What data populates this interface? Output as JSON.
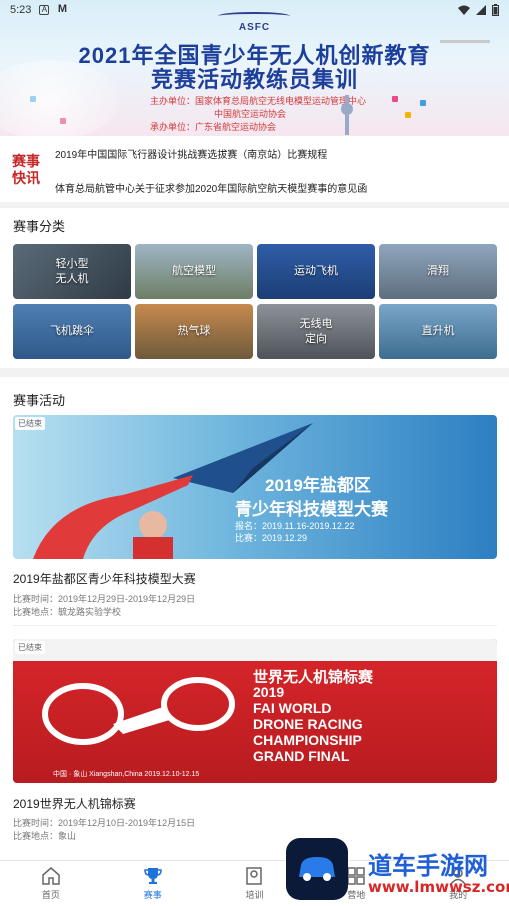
{
  "status_bar": {
    "time": "5:23",
    "icons": [
      "a-icon",
      "m-icon"
    ]
  },
  "banner": {
    "logo": "ASFC",
    "title_line1": "2021年全国青少年无人机创新教育",
    "title_line2": "竞赛活动教练员集训",
    "host": "主办单位：国家体育总局航空无线电模型运动管理中心",
    "host2": "中国航空运动协会",
    "organizer": "承办单位：广东省航空运动协会"
  },
  "news": {
    "badge": "赛事快讯",
    "items": [
      "2019年中国国际飞行器设计挑战赛选拔赛（南京站）比赛规程",
      "体育总局航管中心关于征求参加2020年国际航空航天模型赛事的意见函"
    ]
  },
  "categories": {
    "title": "赛事分类",
    "items": [
      {
        "label": "轻小型\n无人机"
      },
      {
        "label": "航空模型"
      },
      {
        "label": "运动飞机"
      },
      {
        "label": "滑翔"
      },
      {
        "label": "飞机跳伞"
      },
      {
        "label": "热气球"
      },
      {
        "label": "无线电\n定向"
      },
      {
        "label": "直升机"
      }
    ]
  },
  "events": {
    "title": "赛事活动",
    "items": [
      {
        "tag": "已结束",
        "poster_title1": "2019年盐都区",
        "poster_title2": "青少年科技模型大赛",
        "poster_line1": "报名：2019.11.16-2019.12.22",
        "poster_line2": "比赛：2019.12.29",
        "title": "2019年盐都区青少年科技模型大赛",
        "time": "比赛时间：2019年12月29日-2019年12月29日",
        "location": "比赛地点：毓龙路实验学校"
      },
      {
        "tag": "已结束",
        "poster_cn": "世界无人机锦标赛",
        "poster_en1": "2019",
        "poster_en2": "FAI WORLD",
        "poster_en3": "DRONE RACING",
        "poster_en4": "CHAMPIONSHIP",
        "poster_en5": "GRAND FINAL",
        "poster_place": "中国 · 象山 Xiangshan,China 2019.12.10-12.15",
        "title": "2019世界无人机锦标赛",
        "time": "比赛时间：2019年12月10日-2019年12月15日",
        "location": "比赛地点：象山"
      }
    ]
  },
  "tabbar": {
    "items": [
      {
        "label": "首页",
        "icon": "home-icon"
      },
      {
        "label": "赛事",
        "icon": "trophy-icon"
      },
      {
        "label": "培训",
        "icon": "training-icon"
      },
      {
        "label": "营地",
        "icon": "camp-icon"
      },
      {
        "label": "我的",
        "icon": "profile-icon"
      }
    ]
  },
  "watermark": {
    "text": "道车手游网",
    "url": "www.lmwwsz.com"
  },
  "colors": {
    "accent": "#1e73d8",
    "badge": "#c62828",
    "banner_title": "#1d3f9c"
  }
}
